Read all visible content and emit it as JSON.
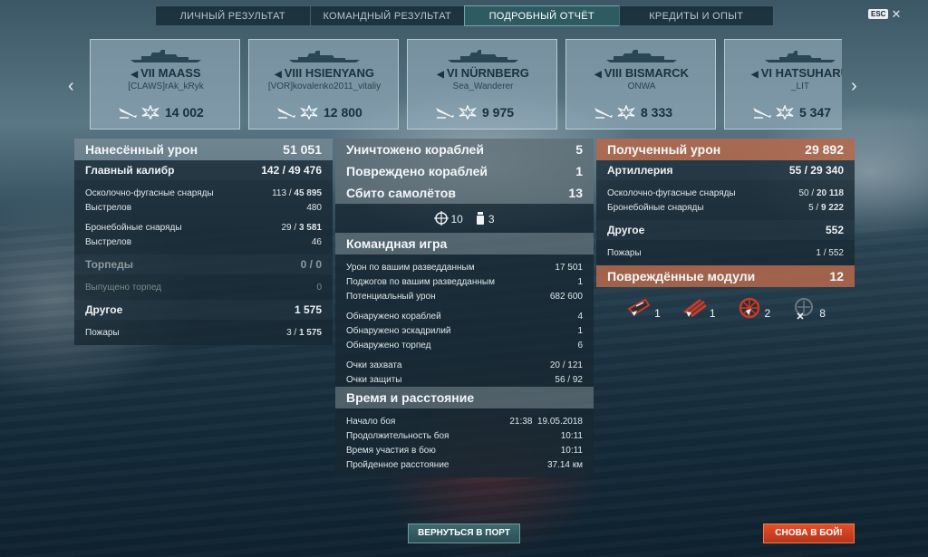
{
  "tabs": [
    {
      "label": "ЛИЧНЫЙ РЕЗУЛЬТАТ"
    },
    {
      "label": "КОМАНДНЫЙ РЕЗУЛЬТАТ"
    },
    {
      "label": "ПОДРОБНЫЙ ОТЧЁТ",
      "active": true
    },
    {
      "label": "КРЕДИТЫ И ОПЫТ"
    }
  ],
  "esc": {
    "key": "ESC",
    "close": "✕"
  },
  "nav": {
    "prev": "‹",
    "next": "›"
  },
  "ships": [
    {
      "tier": "VII",
      "name": "MAASS",
      "player": "[CLAWS]rAk_kRyk",
      "damage": "14 002"
    },
    {
      "tier": "VIII",
      "name": "HSIENYANG",
      "player": "[VOR]kovalenko2011_vitaliy",
      "damage": "12 800"
    },
    {
      "tier": "VI",
      "name": "NÜRNBERG",
      "player": "Sea_Wanderer",
      "damage": "9 975"
    },
    {
      "tier": "VIII",
      "name": "BISMARCK",
      "player": "ONWA",
      "damage": "8 333"
    },
    {
      "tier": "VI",
      "name": "HATSUHARU",
      "player": "_LIT",
      "damage": "5 347"
    }
  ],
  "left": {
    "damage": {
      "label": "Нанесённый урон",
      "value": "51 051"
    },
    "main": {
      "label": "Главный калибр",
      "hits": "142",
      "dmg": "49 476"
    },
    "he": {
      "label": "Осколочно-фугасные снаряды",
      "hits": "113",
      "dmg": "45 895"
    },
    "he_shots": {
      "label": "Выстрелов",
      "value": "480"
    },
    "ap": {
      "label": "Бронебойные снаряды",
      "hits": "29",
      "dmg": "3 581"
    },
    "ap_shots": {
      "label": "Выстрелов",
      "value": "46"
    },
    "torp": {
      "label": "Торпеды",
      "value": "0 / 0"
    },
    "torp_fired": {
      "label": "Выпущено торпед",
      "value": "0"
    },
    "other": {
      "label": "Другое",
      "value": "1 575"
    },
    "fires": {
      "label": "Пожары",
      "hits": "3",
      "dmg": "1 575"
    }
  },
  "middle": {
    "destroyed": {
      "label": "Уничтожено кораблей",
      "value": "5"
    },
    "damaged": {
      "label": "Повреждено кораблей",
      "value": "1"
    },
    "planes": {
      "label": "Сбито самолётов",
      "value": "13"
    },
    "planes_icons": {
      "scope": "10",
      "flask": "3"
    },
    "team": {
      "title": "Командная игра"
    },
    "team_rows": [
      {
        "label": "Урон по вашим разведданным",
        "value": "17 501"
      },
      {
        "label": "Поджогов по вашим разведданным",
        "value": "1"
      },
      {
        "label": "Потенциальный урон",
        "value": "682 600"
      },
      {
        "label": "Обнаружено кораблей",
        "value": "4"
      },
      {
        "label": "Обнаружено эскадрилий",
        "value": "1"
      },
      {
        "label": "Обнаружено торпед",
        "value": "6"
      },
      {
        "label": "Очки захвата",
        "value": "20 / 121"
      },
      {
        "label": "Очки защиты",
        "value": "56 / 92"
      }
    ],
    "time": {
      "title": "Время и расстояние"
    },
    "time_rows": [
      {
        "label": "Начало боя",
        "value": "21:38  19.05.2018"
      },
      {
        "label": "Продолжительность боя",
        "value": "10:11"
      },
      {
        "label": "Время участия в бою",
        "value": "10:11"
      },
      {
        "label": "Пройденное расстояние",
        "value": "37.14 км"
      }
    ]
  },
  "right": {
    "received": {
      "label": "Полученный урон",
      "value": "29 892"
    },
    "artillery": {
      "label": "Артиллерия",
      "hits": "55",
      "dmg": "29 340"
    },
    "he": {
      "label": "Осколочно-фугасные снаряды",
      "hits": "50",
      "dmg": "20 118"
    },
    "ap": {
      "label": "Бронебойные снаряды",
      "hits": "5",
      "dmg": "9 222"
    },
    "other": {
      "label": "Другое",
      "value": "552"
    },
    "fires": {
      "label": "Пожары",
      "value": "1 / 552"
    },
    "modules": {
      "label": "Повреждённые модули",
      "value": "12"
    },
    "module_counts": [
      {
        "icon": "main-battery-icon",
        "count": "1"
      },
      {
        "icon": "torpedo-tubes-icon",
        "count": "1"
      },
      {
        "icon": "steering-gear-icon",
        "count": "2"
      },
      {
        "icon": "engine-icon",
        "count": "8"
      }
    ]
  },
  "buttons": {
    "port": "ВЕРНУТЬСЯ В ПОРТ",
    "battle": "СНОВА В БОЙ!"
  },
  "colors": {
    "accent_red": "#b6684a",
    "active_tab": "#2c5a62",
    "battle_button": "#d9462a"
  }
}
